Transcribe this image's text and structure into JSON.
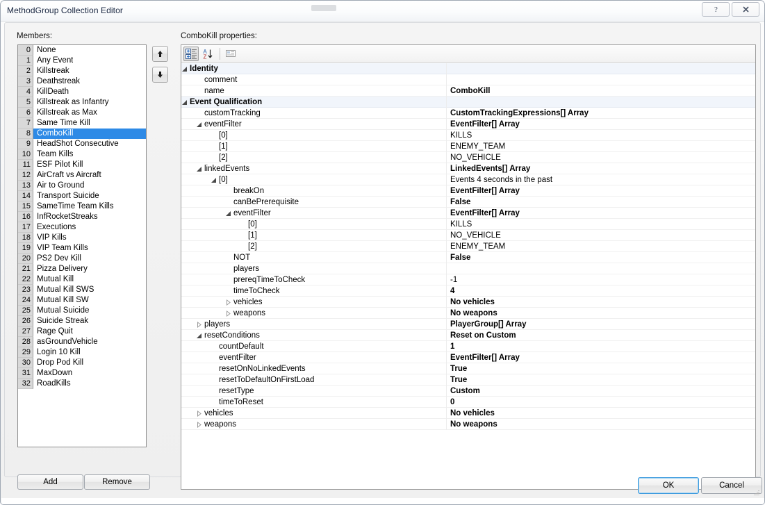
{
  "window": {
    "title": "MethodGroup Collection Editor",
    "help_button": "help-button",
    "close_button": "close-button"
  },
  "members": {
    "label": "Members:",
    "selected_index": 8,
    "items": [
      {
        "index": "0",
        "label": "None"
      },
      {
        "index": "1",
        "label": "Any Event"
      },
      {
        "index": "2",
        "label": "Killstreak"
      },
      {
        "index": "3",
        "label": "Deathstreak"
      },
      {
        "index": "4",
        "label": "KillDeath"
      },
      {
        "index": "5",
        "label": "Killstreak as Infantry"
      },
      {
        "index": "6",
        "label": "Killstreak as Max"
      },
      {
        "index": "7",
        "label": "Same Time Kill"
      },
      {
        "index": "8",
        "label": "ComboKill"
      },
      {
        "index": "9",
        "label": "HeadShot Consecutive"
      },
      {
        "index": "10",
        "label": "Team Kills"
      },
      {
        "index": "11",
        "label": "ESF Pilot Kill"
      },
      {
        "index": "12",
        "label": "AirCraft vs Aircraft"
      },
      {
        "index": "13",
        "label": "Air to Ground"
      },
      {
        "index": "14",
        "label": "Transport Suicide"
      },
      {
        "index": "15",
        "label": "SameTime Team Kills"
      },
      {
        "index": "16",
        "label": "InfRocketStreaks"
      },
      {
        "index": "17",
        "label": "Executions"
      },
      {
        "index": "18",
        "label": "VIP Kills"
      },
      {
        "index": "19",
        "label": "VIP Team Kills"
      },
      {
        "index": "20",
        "label": "PS2 Dev Kill"
      },
      {
        "index": "21",
        "label": "Pizza Delivery"
      },
      {
        "index": "22",
        "label": "Mutual Kill"
      },
      {
        "index": "23",
        "label": "Mutual Kill SWS"
      },
      {
        "index": "24",
        "label": "Mutual Kill SW"
      },
      {
        "index": "25",
        "label": "Mutual Suicide"
      },
      {
        "index": "26",
        "label": "Suicide Streak"
      },
      {
        "index": "27",
        "label": "Rage Quit"
      },
      {
        "index": "28",
        "label": "asGroundVehicle"
      },
      {
        "index": "29",
        "label": "Login 10 Kill"
      },
      {
        "index": "30",
        "label": "Drop Pod Kill"
      },
      {
        "index": "31",
        "label": "MaxDown"
      },
      {
        "index": "32",
        "label": "RoadKills"
      }
    ],
    "move_up_icon": "arrow-up-icon",
    "move_down_icon": "arrow-down-icon",
    "add_label": "Add",
    "remove_label": "Remove"
  },
  "properties": {
    "label": "ComboKill properties:",
    "toolbar": {
      "categorized_icon": "categorized-view-icon",
      "alphabetical_icon": "sort-alphabetical-icon",
      "property_pages_icon": "property-pages-icon"
    },
    "rows": [
      {
        "name": "Identity",
        "value": "",
        "indent": 0,
        "kind": "category",
        "expander": "expanded",
        "bold_value": false
      },
      {
        "name": "comment",
        "value": "",
        "indent": 1,
        "kind": "prop",
        "expander": "none",
        "bold_value": false
      },
      {
        "name": "name",
        "value": "ComboKill",
        "indent": 1,
        "kind": "prop",
        "expander": "none",
        "bold_value": true
      },
      {
        "name": "Event Qualification",
        "value": "",
        "indent": 0,
        "kind": "category",
        "expander": "expanded",
        "bold_value": false
      },
      {
        "name": "customTracking",
        "value": "CustomTrackingExpressions[] Array",
        "indent": 1,
        "kind": "prop",
        "expander": "none",
        "bold_value": true
      },
      {
        "name": "eventFilter",
        "value": "EventFilter[] Array",
        "indent": 1,
        "kind": "prop",
        "expander": "expanded",
        "bold_value": true
      },
      {
        "name": "[0]",
        "value": "KILLS",
        "indent": 2,
        "kind": "prop",
        "expander": "none",
        "bold_value": false
      },
      {
        "name": "[1]",
        "value": "ENEMY_TEAM",
        "indent": 2,
        "kind": "prop",
        "expander": "none",
        "bold_value": false
      },
      {
        "name": "[2]",
        "value": "NO_VEHICLE",
        "indent": 2,
        "kind": "prop",
        "expander": "none",
        "bold_value": false
      },
      {
        "name": "linkedEvents",
        "value": "LinkedEvents[] Array",
        "indent": 1,
        "kind": "prop",
        "expander": "expanded",
        "bold_value": true
      },
      {
        "name": "[0]",
        "value": "Events 4 seconds in the past",
        "indent": 2,
        "kind": "prop",
        "expander": "expanded",
        "bold_value": false
      },
      {
        "name": "breakOn",
        "value": "EventFilter[] Array",
        "indent": 3,
        "kind": "prop",
        "expander": "none",
        "bold_value": true
      },
      {
        "name": "canBePrerequisite",
        "value": "False",
        "indent": 3,
        "kind": "prop",
        "expander": "none",
        "bold_value": true
      },
      {
        "name": "eventFilter",
        "value": "EventFilter[] Array",
        "indent": 3,
        "kind": "prop",
        "expander": "expanded",
        "bold_value": true
      },
      {
        "name": "[0]",
        "value": "KILLS",
        "indent": 4,
        "kind": "prop",
        "expander": "none",
        "bold_value": false
      },
      {
        "name": "[1]",
        "value": "NO_VEHICLE",
        "indent": 4,
        "kind": "prop",
        "expander": "none",
        "bold_value": false
      },
      {
        "name": "[2]",
        "value": "ENEMY_TEAM",
        "indent": 4,
        "kind": "prop",
        "expander": "none",
        "bold_value": false
      },
      {
        "name": "NOT",
        "value": "False",
        "indent": 3,
        "kind": "prop",
        "expander": "none",
        "bold_value": true
      },
      {
        "name": "players",
        "value": "",
        "indent": 3,
        "kind": "prop",
        "expander": "none",
        "bold_value": false
      },
      {
        "name": "prereqTimeToCheck",
        "value": "-1",
        "indent": 3,
        "kind": "prop",
        "expander": "none",
        "bold_value": false
      },
      {
        "name": "timeToCheck",
        "value": "4",
        "indent": 3,
        "kind": "prop",
        "expander": "none",
        "bold_value": true
      },
      {
        "name": "vehicles",
        "value": "No vehicles",
        "indent": 3,
        "kind": "prop",
        "expander": "collapsed",
        "bold_value": true
      },
      {
        "name": "weapons",
        "value": "No weapons",
        "indent": 3,
        "kind": "prop",
        "expander": "collapsed",
        "bold_value": true
      },
      {
        "name": "players",
        "value": "PlayerGroup[] Array",
        "indent": 1,
        "kind": "prop",
        "expander": "collapsed",
        "bold_value": true
      },
      {
        "name": "resetConditions",
        "value": "Reset on Custom",
        "indent": 1,
        "kind": "prop",
        "expander": "expanded",
        "bold_value": true
      },
      {
        "name": "countDefault",
        "value": "1",
        "indent": 2,
        "kind": "prop",
        "expander": "none",
        "bold_value": true
      },
      {
        "name": "eventFilter",
        "value": "EventFilter[] Array",
        "indent": 2,
        "kind": "prop",
        "expander": "none",
        "bold_value": true
      },
      {
        "name": "resetOnNoLinkedEvents",
        "value": "True",
        "indent": 2,
        "kind": "prop",
        "expander": "none",
        "bold_value": true
      },
      {
        "name": "resetToDefaultOnFirstLoad",
        "value": "True",
        "indent": 2,
        "kind": "prop",
        "expander": "none",
        "bold_value": true
      },
      {
        "name": "resetType",
        "value": "Custom",
        "indent": 2,
        "kind": "prop",
        "expander": "none",
        "bold_value": true
      },
      {
        "name": "timeToReset",
        "value": "0",
        "indent": 2,
        "kind": "prop",
        "expander": "none",
        "bold_value": true
      },
      {
        "name": "vehicles",
        "value": "No vehicles",
        "indent": 1,
        "kind": "prop",
        "expander": "collapsed",
        "bold_value": true
      },
      {
        "name": "weapons",
        "value": "No weapons",
        "indent": 1,
        "kind": "prop",
        "expander": "collapsed",
        "bold_value": true
      }
    ]
  },
  "dialog": {
    "ok_label": "OK",
    "cancel_label": "Cancel"
  },
  "colors": {
    "selection": "#2e8ae6",
    "category_row": "#f1f5fb",
    "focus_ring": "#3c9ade"
  }
}
